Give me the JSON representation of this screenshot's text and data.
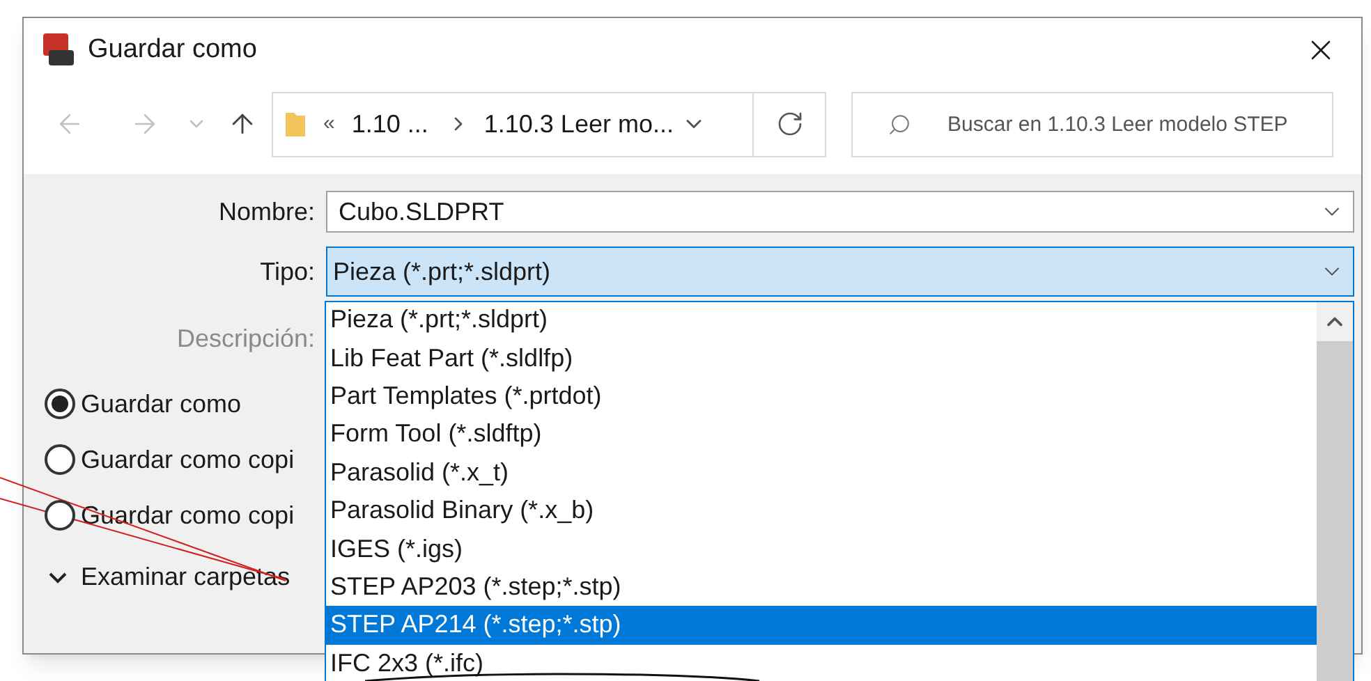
{
  "window": {
    "title": "Guardar como"
  },
  "navigation": {
    "overflow": "«",
    "path": [
      "1.10 ...",
      "1.10.3 Leer mo..."
    ],
    "search_placeholder": "Buscar en 1.10.3 Leer modelo STEP"
  },
  "form": {
    "name_label": "Nombre:",
    "name_value": "Cubo.SLDPRT",
    "type_label": "Tipo:",
    "type_value": "Pieza (*.prt;*.sldprt)",
    "description_label": "Descripción:"
  },
  "save_options": [
    {
      "label": "Guardar como",
      "selected": true
    },
    {
      "label": "Guardar como copi",
      "selected": false
    },
    {
      "label": "Guardar como copi",
      "selected": false
    }
  ],
  "browse_folders": {
    "label": "Examinar carpetas",
    "expanded": false
  },
  "type_options": [
    {
      "label": "Pieza (*.prt;*.sldprt)",
      "selected": false
    },
    {
      "label": "Lib Feat Part (*.sldlfp)",
      "selected": false
    },
    {
      "label": "Part Templates (*.prtdot)",
      "selected": false
    },
    {
      "label": "Form Tool (*.sldftp)",
      "selected": false
    },
    {
      "label": "Parasolid (*.x_t)",
      "selected": false
    },
    {
      "label": "Parasolid Binary (*.x_b)",
      "selected": false
    },
    {
      "label": "IGES (*.igs)",
      "selected": false
    },
    {
      "label": "STEP AP203 (*.step;*.stp)",
      "selected": false
    },
    {
      "label": "STEP AP214 (*.step;*.stp)",
      "selected": true
    },
    {
      "label": "IFC 2x3 (*.ifc)",
      "selected": false
    }
  ]
}
